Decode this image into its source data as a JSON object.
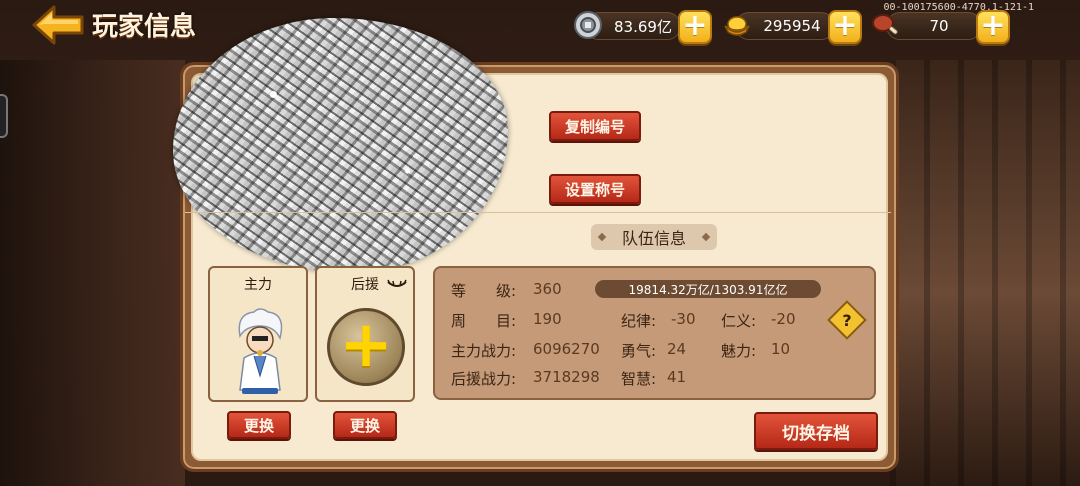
{
  "header": {
    "title": "玩家信息",
    "version": "00-100175600-4770.1-121-1"
  },
  "resources": {
    "silver": {
      "icon": "silver-coin-icon",
      "value": "83.69亿"
    },
    "gold": {
      "icon": "gold-ingot-icon",
      "value": "295954"
    },
    "stamina": {
      "icon": "meat-icon",
      "value": "70"
    },
    "plus_icon": "plus-icon"
  },
  "profile": {
    "copy_id_label": "复制编号",
    "set_title_label": "设置称号"
  },
  "team": {
    "section_title": "队伍信息",
    "main_slot_label": "主力",
    "support_slot_label": "后援",
    "swap_label": "更换",
    "switch_save_label": "切换存档",
    "stats": {
      "level_label": "等　　级:",
      "level_value": "360",
      "exp_text": "19814.32万亿/1303.91亿亿",
      "round_label": "周　　目:",
      "round_value": "190",
      "discipline_label": "纪律:",
      "discipline_value": "-30",
      "benevolence_label": "仁义:",
      "benevolence_value": "-20",
      "main_power_label": "主力战力:",
      "main_power_value": "6096270",
      "courage_label": "勇气:",
      "courage_value": "24",
      "charm_label": "魅力:",
      "charm_value": "10",
      "support_power_label": "后援战力:",
      "support_power_value": "3718298",
      "wisdom_label": "智慧:",
      "wisdom_value": "41",
      "help_glyph": "?"
    }
  },
  "colors": {
    "panel_bg": "#f7ead0",
    "button_red": "#c8341f",
    "plus_yellow": "#ffd43a",
    "info_box": "#c59a78"
  }
}
